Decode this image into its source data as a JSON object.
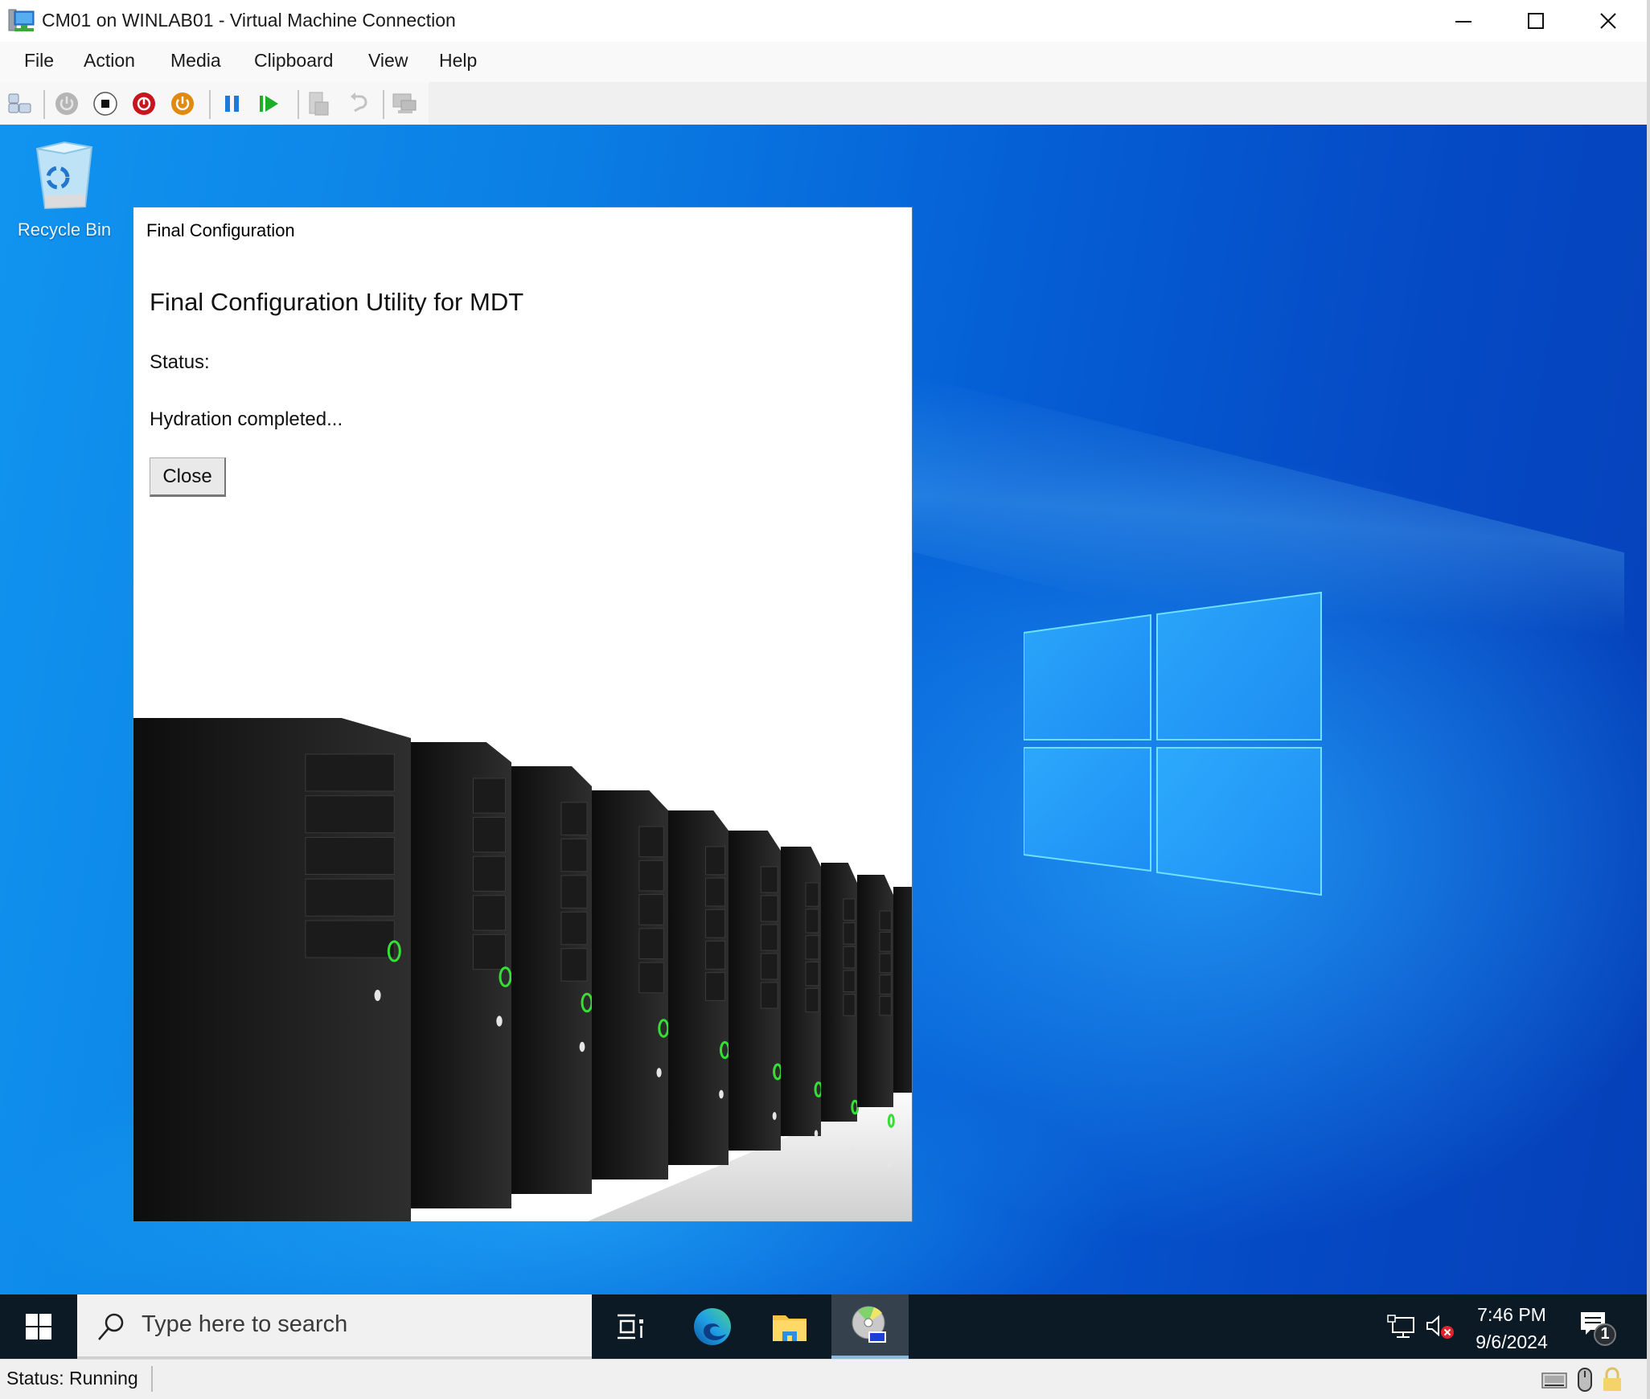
{
  "window": {
    "title": "CM01 on WINLAB01 - Virtual Machine Connection",
    "controls": {
      "minimize": "minimize",
      "maximize": "maximize",
      "close": "close"
    }
  },
  "menubar": {
    "items": [
      {
        "label": "File"
      },
      {
        "label": "Action"
      },
      {
        "label": "Media"
      },
      {
        "label": "Clipboard"
      },
      {
        "label": "View"
      },
      {
        "label": "Help"
      }
    ]
  },
  "toolbar": {
    "buttons": [
      {
        "name": "ctrl-alt-del",
        "icon": "ctrl-alt-del-icon",
        "enabled": true
      },
      {
        "name": "start",
        "icon": "power-gray-icon",
        "enabled": false
      },
      {
        "name": "turn-off",
        "icon": "stop-icon",
        "enabled": true
      },
      {
        "name": "shut-down",
        "icon": "power-red-icon",
        "enabled": true
      },
      {
        "name": "save",
        "icon": "power-orange-icon",
        "enabled": true
      },
      {
        "name": "pause",
        "icon": "pause-icon",
        "enabled": true
      },
      {
        "name": "reset",
        "icon": "reset-play-icon",
        "enabled": true
      },
      {
        "name": "checkpoint",
        "icon": "checkpoint-icon",
        "enabled": false
      },
      {
        "name": "revert",
        "icon": "revert-icon",
        "enabled": false
      },
      {
        "name": "enhanced-session",
        "icon": "enhanced-session-icon",
        "enabled": false
      }
    ],
    "colors": {
      "stop_red": "#c8141e",
      "save_orange": "#e08a10",
      "pause_blue": "#1c7ad8",
      "play_green": "#1cae2a"
    }
  },
  "desktop": {
    "icons": [
      {
        "label": "Recycle Bin"
      }
    ],
    "wallpaper_colors": {
      "light": "#1194f0",
      "dark": "#0540b8"
    }
  },
  "dialog": {
    "title": "Final Configuration",
    "heading": "Final Configuration Utility for MDT",
    "status_label": "Status:",
    "status_message": "Hydration completed...",
    "close_button": "Close"
  },
  "taskbar": {
    "search_placeholder": "Type here to search",
    "apps": [
      {
        "name": "task-view",
        "active": false
      },
      {
        "name": "microsoft-edge",
        "active": false
      },
      {
        "name": "file-explorer",
        "active": false
      },
      {
        "name": "final-configuration",
        "active": true
      }
    ],
    "tray": {
      "time": "7:46 PM",
      "date": "9/6/2024",
      "notification_count": "1"
    }
  },
  "statusbar": {
    "status": "Status: Running"
  }
}
